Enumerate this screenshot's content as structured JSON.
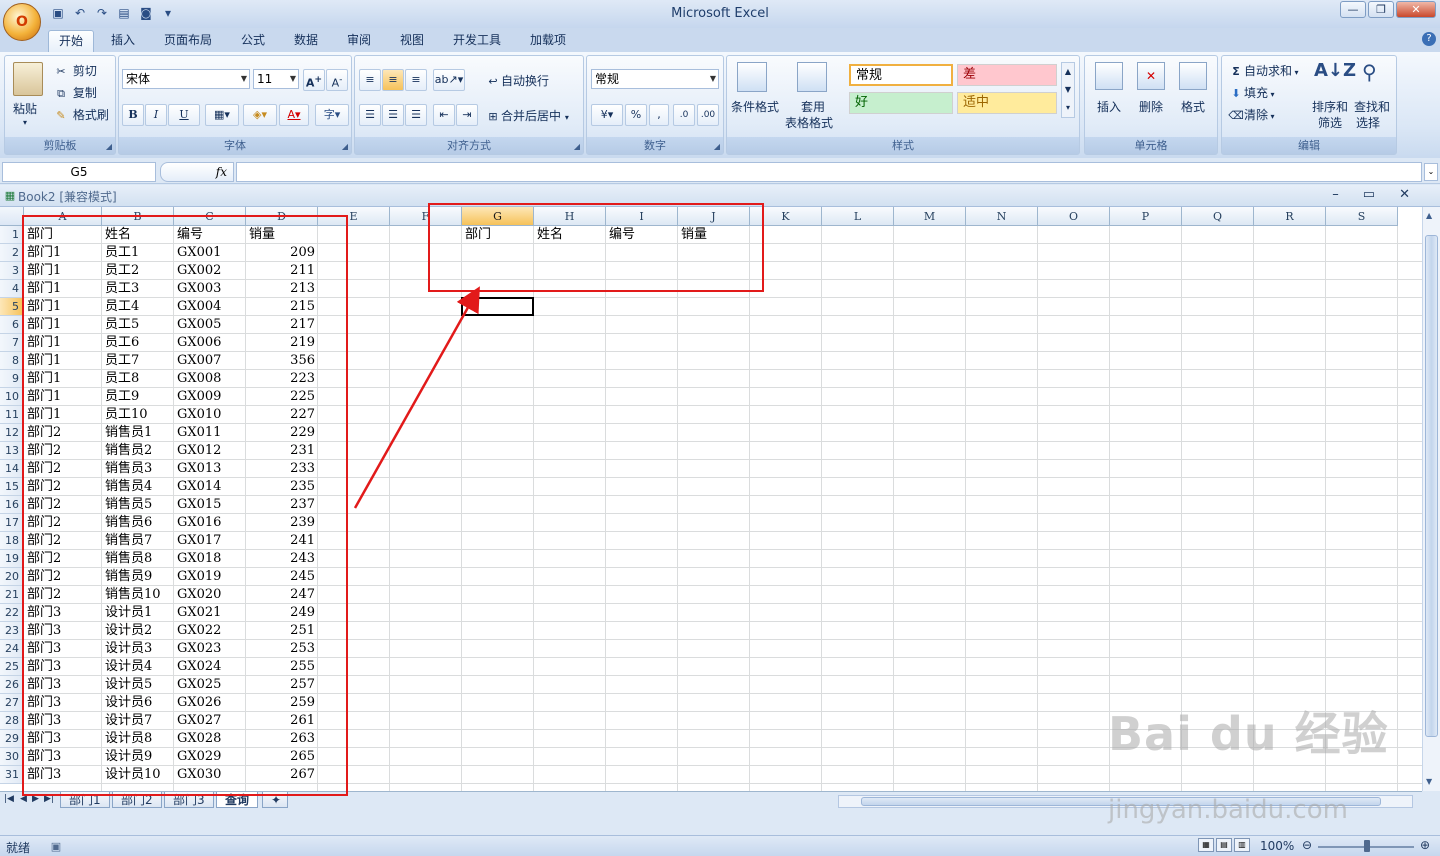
{
  "app": {
    "title": "Microsoft Excel",
    "office_button_label": "O"
  },
  "ribbon_tabs": [
    "开始",
    "插入",
    "页面布局",
    "公式",
    "数据",
    "审阅",
    "视图",
    "开发工具",
    "加载项"
  ],
  "ribbon": {
    "clipboard": {
      "label": "剪贴板",
      "paste": "粘贴",
      "cut": "剪切",
      "copy": "复制",
      "format_painter": "格式刷"
    },
    "font": {
      "label": "字体",
      "font_name": "宋体",
      "font_size": "11",
      "bold": "B",
      "italic": "I",
      "underline": "U"
    },
    "alignment": {
      "label": "对齐方式",
      "wrap": "自动换行",
      "merge": "合并后居中"
    },
    "number": {
      "label": "数字",
      "format": "常规",
      "percent": "%",
      "comma": ","
    },
    "styles": {
      "label": "样式",
      "conditional": "条件格式",
      "table_format_1": "套用",
      "table_format_2": "表格格式",
      "normal": "常规",
      "bad": "差",
      "good": "好",
      "neutral": "适中"
    },
    "cells": {
      "label": "单元格",
      "insert": "插入",
      "delete": "删除",
      "format": "格式"
    },
    "editing": {
      "label": "编辑",
      "autosum": "自动求和",
      "fill": "填充",
      "clear": "清除",
      "sort_1": "排序和",
      "sort_2": "筛选",
      "find_1": "查找和",
      "find_2": "选择"
    }
  },
  "formula_bar": {
    "name_box": "G5",
    "fx": "fx",
    "value": ""
  },
  "workbook": {
    "title": "Book2  [兼容模式]"
  },
  "columns": [
    "A",
    "B",
    "C",
    "D",
    "E",
    "F",
    "G",
    "H",
    "I",
    "J",
    "K",
    "L",
    "M",
    "N",
    "O",
    "P",
    "Q",
    "R",
    "S"
  ],
  "rows": [
    [
      "部门",
      "姓名",
      "编号",
      "销量"
    ],
    [
      "部门1",
      "员工1",
      "GX001",
      "209"
    ],
    [
      "部门1",
      "员工2",
      "GX002",
      "211"
    ],
    [
      "部门1",
      "员工3",
      "GX003",
      "213"
    ],
    [
      "部门1",
      "员工4",
      "GX004",
      "215"
    ],
    [
      "部门1",
      "员工5",
      "GX005",
      "217"
    ],
    [
      "部门1",
      "员工6",
      "GX006",
      "219"
    ],
    [
      "部门1",
      "员工7",
      "GX007",
      "356"
    ],
    [
      "部门1",
      "员工8",
      "GX008",
      "223"
    ],
    [
      "部门1",
      "员工9",
      "GX009",
      "225"
    ],
    [
      "部门1",
      "员工10",
      "GX010",
      "227"
    ],
    [
      "部门2",
      "销售员1",
      "GX011",
      "229"
    ],
    [
      "部门2",
      "销售员2",
      "GX012",
      "231"
    ],
    [
      "部门2",
      "销售员3",
      "GX013",
      "233"
    ],
    [
      "部门2",
      "销售员4",
      "GX014",
      "235"
    ],
    [
      "部门2",
      "销售员5",
      "GX015",
      "237"
    ],
    [
      "部门2",
      "销售员6",
      "GX016",
      "239"
    ],
    [
      "部门2",
      "销售员7",
      "GX017",
      "241"
    ],
    [
      "部门2",
      "销售员8",
      "GX018",
      "243"
    ],
    [
      "部门2",
      "销售员9",
      "GX019",
      "245"
    ],
    [
      "部门2",
      "销售员10",
      "GX020",
      "247"
    ],
    [
      "部门3",
      "设计员1",
      "GX021",
      "249"
    ],
    [
      "部门3",
      "设计员2",
      "GX022",
      "251"
    ],
    [
      "部门3",
      "设计员3",
      "GX023",
      "253"
    ],
    [
      "部门3",
      "设计员4",
      "GX024",
      "255"
    ],
    [
      "部门3",
      "设计员5",
      "GX025",
      "257"
    ],
    [
      "部门3",
      "设计员6",
      "GX026",
      "259"
    ],
    [
      "部门3",
      "设计员7",
      "GX027",
      "261"
    ],
    [
      "部门3",
      "设计员8",
      "GX028",
      "263"
    ],
    [
      "部门3",
      "设计员9",
      "GX029",
      "265"
    ],
    [
      "部门3",
      "设计员10",
      "GX030",
      "267"
    ]
  ],
  "query_headers": [
    "部门",
    "姓名",
    "编号",
    "销量"
  ],
  "sheet_tabs": [
    "部门1",
    "部门2",
    "部门3",
    "查询"
  ],
  "status": {
    "ready": "就绪",
    "zoom": "100%"
  },
  "watermark": {
    "logo": "Bai du 经验",
    "url": "jingyan.baidu.com"
  },
  "colors": {
    "accent": "#e21a1a",
    "selected_header": "#f6c25a",
    "ribbon_bg": "#dbe7f6"
  }
}
